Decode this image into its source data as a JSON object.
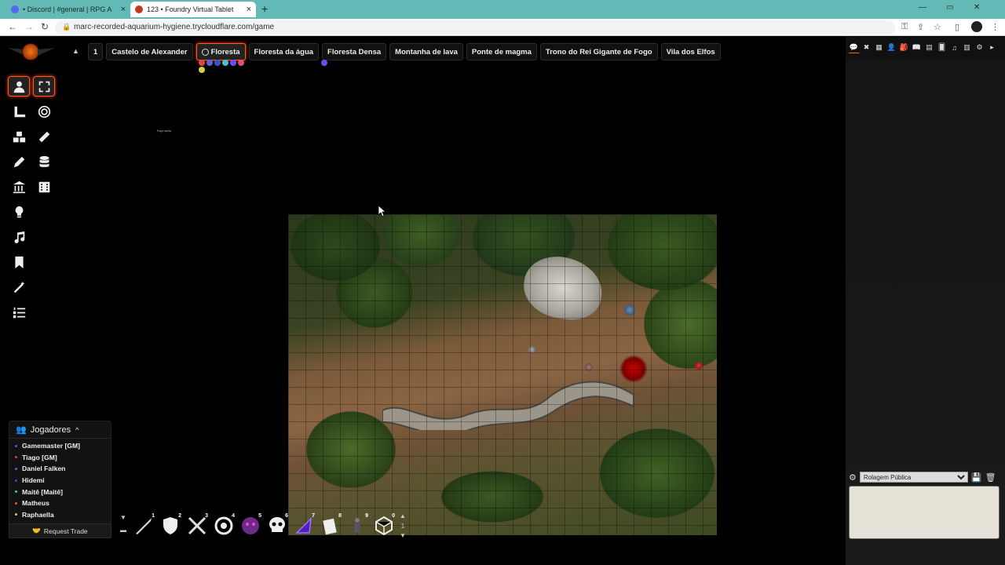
{
  "browser": {
    "tabs": [
      {
        "label": "• Discord | #general | RPG A",
        "favicon_color": "#5865f2"
      },
      {
        "label": "123 • Foundry Virtual Tablet",
        "favicon_color": "#c0391b"
      }
    ],
    "url": "marc-recorded-aquarium-hygiene.trycloudflare.com/game"
  },
  "scene_nav": {
    "page_number": "1",
    "scenes": [
      {
        "label": "Castelo de Alexander",
        "active": false
      },
      {
        "label": "Floresta",
        "active": true
      },
      {
        "label": "Floresta da água",
        "active": false
      },
      {
        "label": "Floresta Densa",
        "active": false
      },
      {
        "label": "Montanha de lava",
        "active": false
      },
      {
        "label": "Ponte de magma",
        "active": false
      },
      {
        "label": "Trono do Rei Gigante de Fogo",
        "active": false
      },
      {
        "label": "Vila dos Elfos",
        "active": false
      }
    ]
  },
  "map": {
    "token_label": "Raphaella"
  },
  "players": {
    "title": "Jogadores",
    "list": [
      {
        "name": "Gamemaster [GM]",
        "color": "#6a4cff"
      },
      {
        "name": "Tiago [GM]",
        "color": "#e24444"
      },
      {
        "name": "Daniel Falken",
        "color": "#5566dd"
      },
      {
        "name": "Hidemi",
        "color": "#3355cc"
      },
      {
        "name": "Maitê [Maitê]",
        "color": "#44c4c4"
      },
      {
        "name": "Matheus",
        "color": "#e0506e"
      },
      {
        "name": "Raphaella",
        "color": "#d8d040"
      }
    ],
    "trade_label": "Request Trade"
  },
  "hotbar": {
    "slots": [
      "1",
      "2",
      "3",
      "4",
      "5",
      "6",
      "7",
      "8",
      "9",
      "0"
    ],
    "page": "1"
  },
  "sidebar": {
    "roll_mode": "Rolagem Pública"
  },
  "colors": {
    "accent": "#ff5a2a",
    "browser_bar": "#63b9b6"
  }
}
